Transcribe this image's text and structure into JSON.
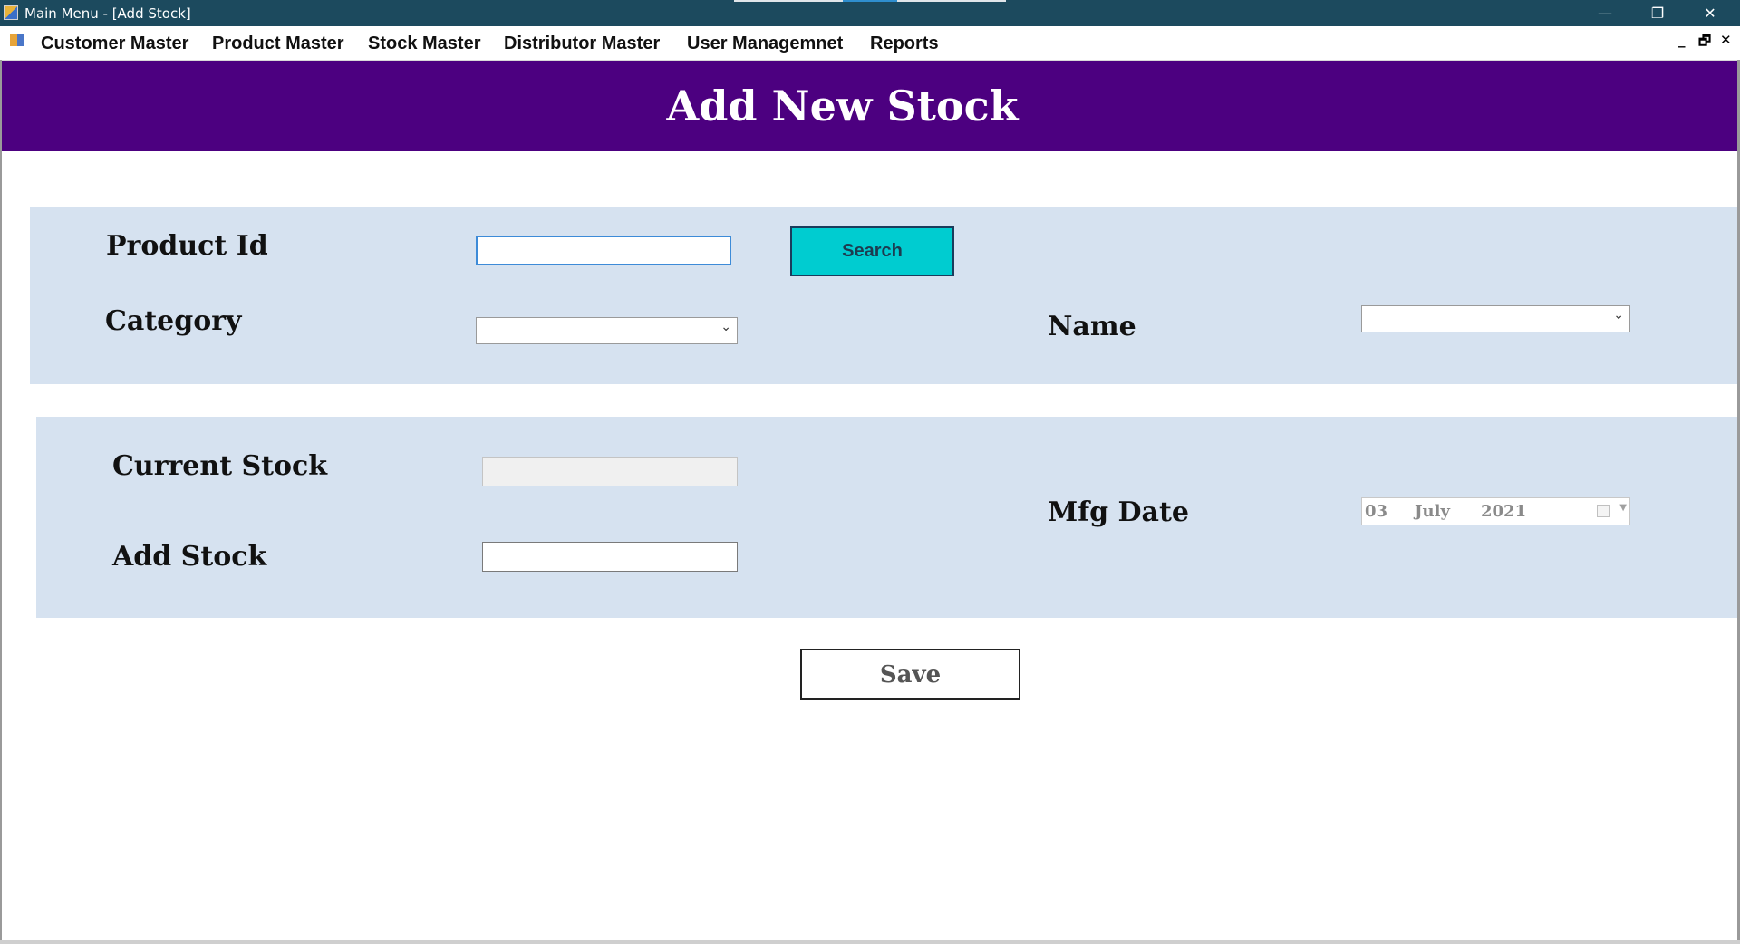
{
  "window": {
    "title": "Main Menu - [Add Stock]",
    "controls": {
      "minimize": "—",
      "restore": "❐",
      "close": "✕"
    }
  },
  "menu": {
    "items": [
      {
        "label": "Customer Master"
      },
      {
        "label": "Product Master"
      },
      {
        "label": "Stock Master"
      },
      {
        "label": "Distributor Master"
      },
      {
        "label": "User Managemnet"
      },
      {
        "label": "Reports"
      }
    ],
    "mdi_controls": {
      "minimize": "_",
      "restore": "🗗",
      "close": "✕"
    }
  },
  "form": {
    "heading": "Add New Stock",
    "colors": {
      "banner": "#4c0080",
      "panel": "#d6e2f0",
      "search_button": "#00ccd0"
    },
    "product_id": {
      "label": "Product Id",
      "value": ""
    },
    "search_button": {
      "label": "Search"
    },
    "category": {
      "label": "Category",
      "selected": ""
    },
    "name": {
      "label": "Name",
      "selected": ""
    },
    "current_stock": {
      "label": "Current Stock",
      "value": ""
    },
    "add_stock": {
      "label": "Add Stock",
      "value": ""
    },
    "mfg_date": {
      "label": "Mfg Date",
      "day": "03",
      "month": "July",
      "year": "2021"
    },
    "save_button": {
      "label": "Save"
    }
  }
}
